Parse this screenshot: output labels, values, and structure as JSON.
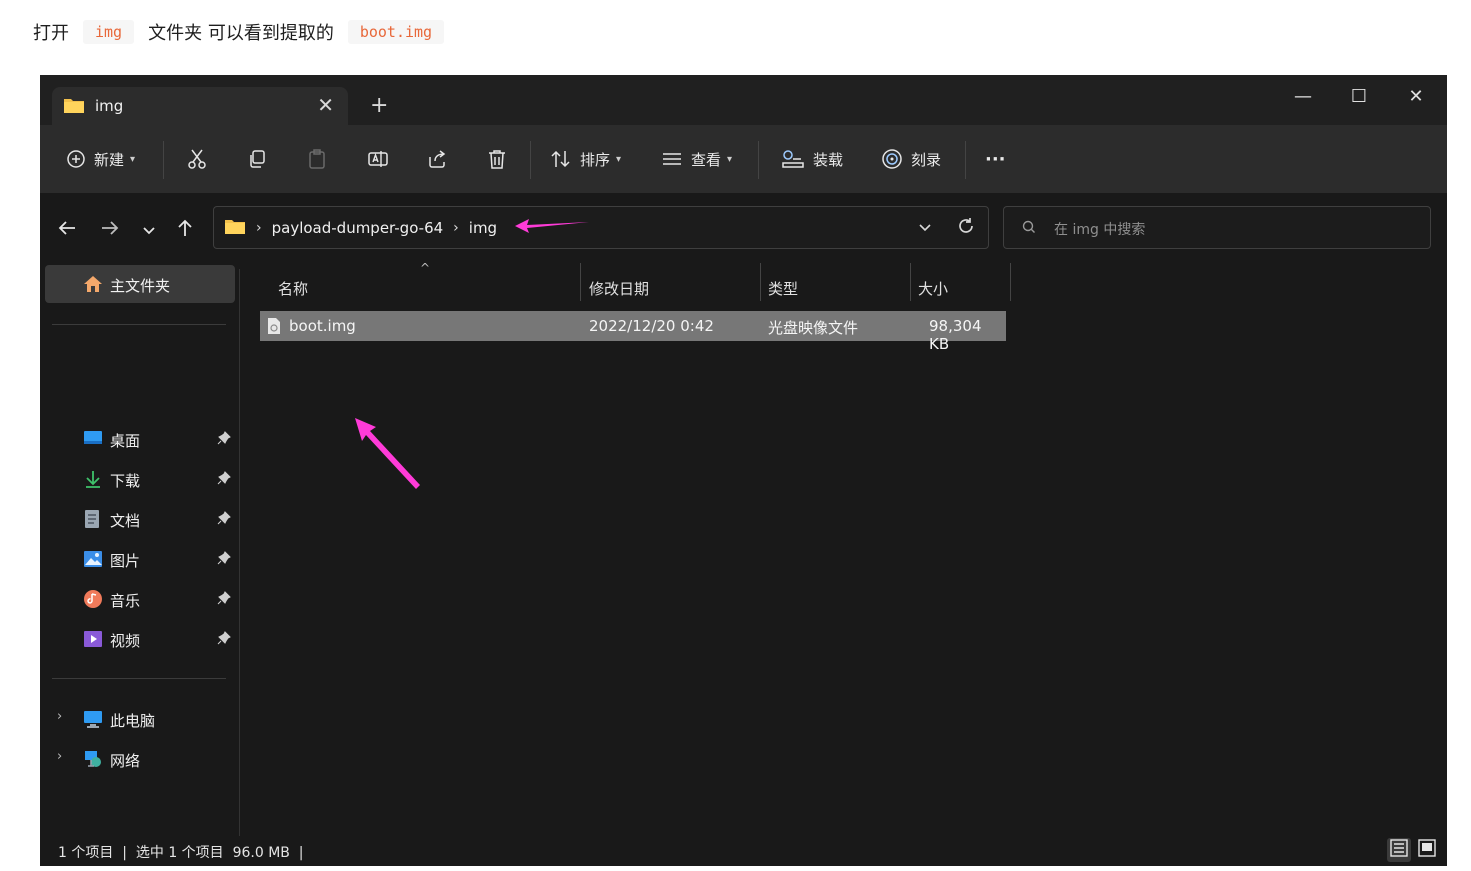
{
  "intro": {
    "text1": "打开",
    "code1": "img",
    "text2": "文件夹 可以看到提取的",
    "code2": "boot.img"
  },
  "window": {
    "tab_title": "img",
    "tab_close": "✕",
    "new_tab": "+",
    "controls": {
      "minimize": "—",
      "maximize": "☐",
      "close": "✕"
    }
  },
  "toolbar": {
    "new_label": "新建",
    "sort_label": "排序",
    "view_label": "查看",
    "mount_label": "装载",
    "burn_label": "刻录",
    "more_label": "···",
    "icons": [
      "new-icon",
      "cut-icon",
      "copy-icon",
      "paste-icon",
      "rename-icon",
      "share-icon",
      "delete-icon",
      "sort-icon",
      "view-icon",
      "mount-icon",
      "burn-icon",
      "more-icon"
    ]
  },
  "address": {
    "crumbs": [
      "payload-dumper-go-64",
      "img"
    ],
    "search_placeholder": "在 img 中搜索"
  },
  "sidebar": {
    "home": "主文件夹",
    "quick": [
      {
        "label": "桌面",
        "icon": "desktop-icon"
      },
      {
        "label": "下载",
        "icon": "download-icon"
      },
      {
        "label": "文档",
        "icon": "document-icon"
      },
      {
        "label": "图片",
        "icon": "picture-icon"
      },
      {
        "label": "音乐",
        "icon": "music-icon"
      },
      {
        "label": "视频",
        "icon": "video-icon"
      }
    ],
    "this_pc": "此电脑",
    "network": "网络"
  },
  "files": {
    "columns": [
      "名称",
      "修改日期",
      "类型",
      "大小"
    ],
    "rows": [
      {
        "name": "boot.img",
        "modified": "2022/12/20 0:42",
        "type": "光盘映像文件",
        "size": "98,304 KB"
      }
    ]
  },
  "status": {
    "text": "1 个项目  |  选中 1 个项目  96.0 MB  |"
  },
  "colors": {
    "window_bg": "#191919",
    "toolbar_bg": "#2c2c2c",
    "selected_row": "#777777",
    "annotation_arrow": "#ff3bd8",
    "code_text": "#e8683a"
  }
}
